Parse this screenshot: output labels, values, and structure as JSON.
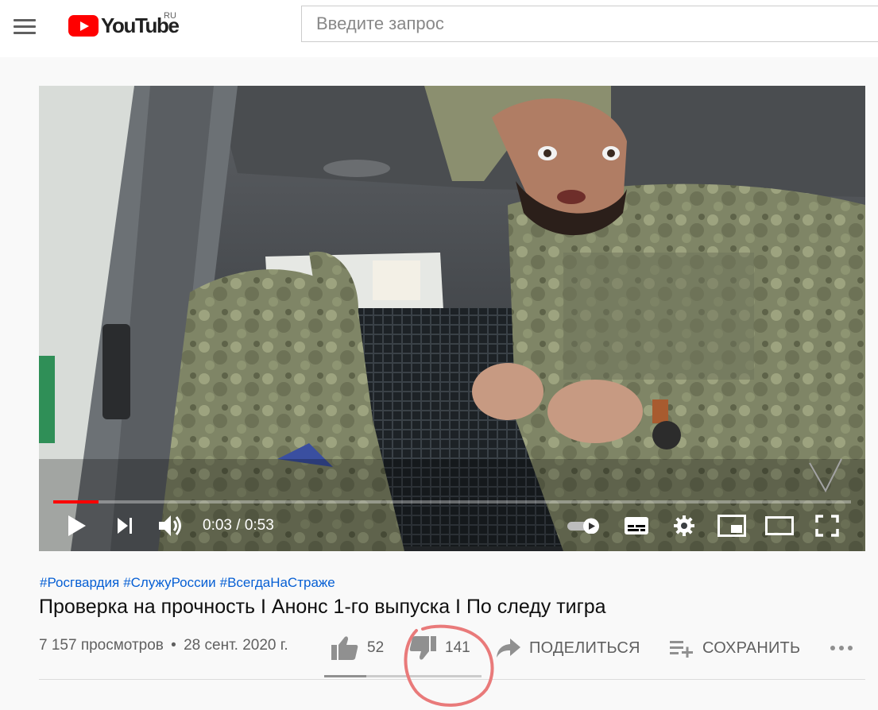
{
  "header": {
    "logo_text": "YouTube",
    "country_code": "RU",
    "search_placeholder": "Введите запрос"
  },
  "player": {
    "current_time": "0:03",
    "separator": " / ",
    "duration": "0:53",
    "progress_fraction": 0.057
  },
  "video": {
    "hashtags": [
      "#Росгвардия",
      "#СлужуРоссии",
      "#ВсегдаНаСтраже"
    ],
    "title": "Проверка на прочность I Анонс 1-го выпуска I По следу тигра",
    "views": "7 157 просмотров",
    "date_separator": "•",
    "date": "28 сент. 2020 г."
  },
  "actions": {
    "likes": "52",
    "dislikes": "141",
    "share_label": "ПОДЕЛИТЬСЯ",
    "save_label": "СОХРАНИТЬ",
    "like_fraction": 0.27
  },
  "colors": {
    "brand_red": "#ff0000",
    "link_blue": "#065fd4",
    "annotation_red": "#e97a7a"
  }
}
